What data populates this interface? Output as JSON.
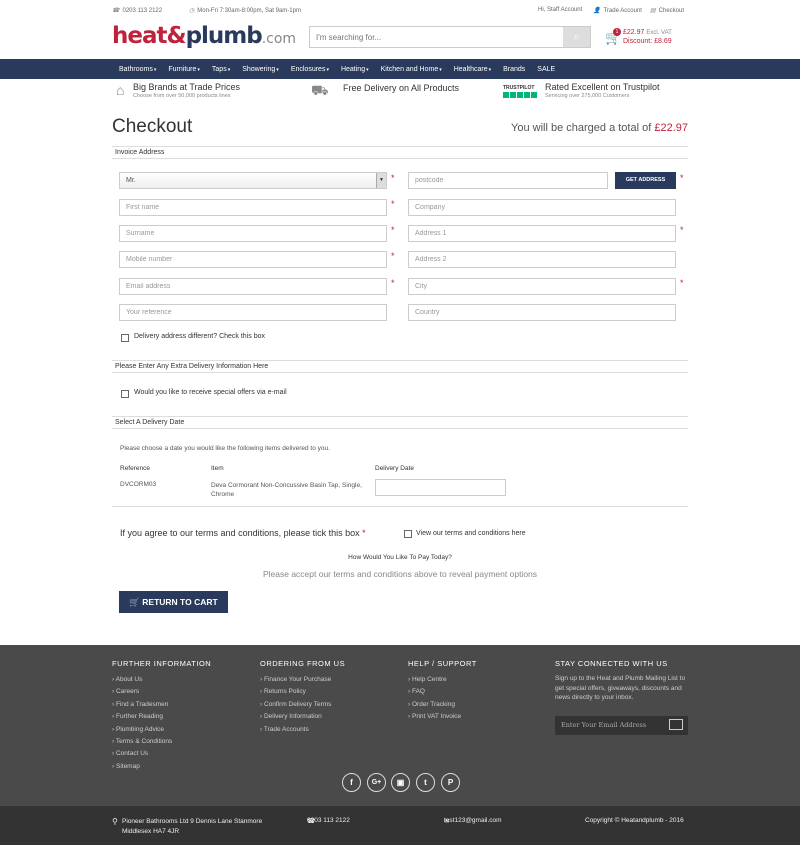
{
  "topbar": {
    "phone": "0203 113 2122",
    "hours": "Mon-Fri 7:30am-8:00pm, Sat 9am-1pm",
    "greeting": "Hi, Staff Account",
    "trade": "Trade Account",
    "checkout": "Checkout"
  },
  "logo": {
    "a": "heat",
    "amp": "&",
    "b": "plumb",
    ".com": ".com"
  },
  "search": {
    "placeholder": "I'm searching for..."
  },
  "cart": {
    "count": "1",
    "total": "£22.97",
    "exvat": "Excl. VAT",
    "discount": "Discount: £8.69"
  },
  "nav": [
    "Bathrooms",
    "Furniture",
    "Taps",
    "Showering",
    "Enclosures",
    "Heating",
    "Kitchen and Home",
    "Healthcare",
    "Brands",
    "SALE"
  ],
  "usp": {
    "u1": "Big Brands at Trade Prices",
    "u1s": "Choose from over 50,000 products lines",
    "u2": "Free Delivery on All Products",
    "tp": "TRUSTPILOT",
    "u3": "Rated Excellent on Trustpilot",
    "u3s": "Servicing over 275,000 Customers"
  },
  "checkout": {
    "title": "Checkout",
    "total_prefix": "You will be charged a total of ",
    "total": "£22.97"
  },
  "invoice": {
    "heading": "Invoice Address",
    "title": "Mr.",
    "postcode": "postcode",
    "get_address": "GET ADDRESS",
    "first_name": "First name",
    "company": "Company",
    "surname": "Surname",
    "address1": "Address 1",
    "mobile": "Mobile number",
    "address2": "Address 2",
    "email": "Email address",
    "city": "City",
    "reference": "Your reference",
    "country": "Country",
    "delivery_diff": "Delivery address different? Check this box"
  },
  "extra": {
    "heading": "Please Enter Any Extra Delivery Information Here",
    "offers": "Would you like to receive special offers via e-mail"
  },
  "delivery": {
    "heading": "Select A Delivery Date",
    "intro": "Please choose a date you would like the following items delivered to you.",
    "col_ref": "Reference",
    "col_item": "Item",
    "col_date": "Delivery Date",
    "ref": "DVCORM03",
    "item": "Deva Cormorant Non-Concussive Basin Tap, Single, Chrome"
  },
  "terms": {
    "text": "If you agree to our terms and conditions, please tick this box ",
    "star": "*",
    "link": "View our terms and conditions here",
    "pay_q": "How Would You Like To Pay Today?",
    "pay_msg": "Please accept our terms and conditions above to reveal payment options",
    "return": "RETURN TO CART"
  },
  "footer": {
    "c1": {
      "h": "FURTHER INFORMATION",
      "items": [
        "About Us",
        "Careers",
        "Find a Tradesmen",
        "Further Reading",
        "Plumbing Advice",
        "Terms & Conditions",
        "Contact Us",
        "Sitemap"
      ]
    },
    "c2": {
      "h": "ORDERING FROM US",
      "items": [
        "Finance Your Purchase",
        "Returns Policy",
        "Confirm Delivery Terms",
        "Delivery Information",
        "Trade Accounts"
      ]
    },
    "c3": {
      "h": "HELP / SUPPORT",
      "items": [
        "Help Centre",
        "FAQ",
        "Order Tracking",
        "Print VAT Invoice"
      ]
    },
    "c4": {
      "h": "STAY CONNECTED WITH US",
      "text": "Sign up to the Heat and Plumb Mailing List to get special offers, giveaways, discounts and news directly to your inbox.",
      "placeholder": "Enter Your Email Address"
    },
    "social": [
      "f",
      "G+",
      "▣",
      "t",
      "P"
    ],
    "address": "Pioneer Bathrooms Ltd 9 Dennis Lane Stanmore Middlesex HA7 4JR",
    "phone": "0203 113 2122",
    "email": "test123@gmail.com",
    "copyright": "Copyright © Heatandplumb - 2016"
  },
  "colors": {
    "navy": "#2a3a5c",
    "red": "#c0223b",
    "footer": "#4a4a4a"
  }
}
